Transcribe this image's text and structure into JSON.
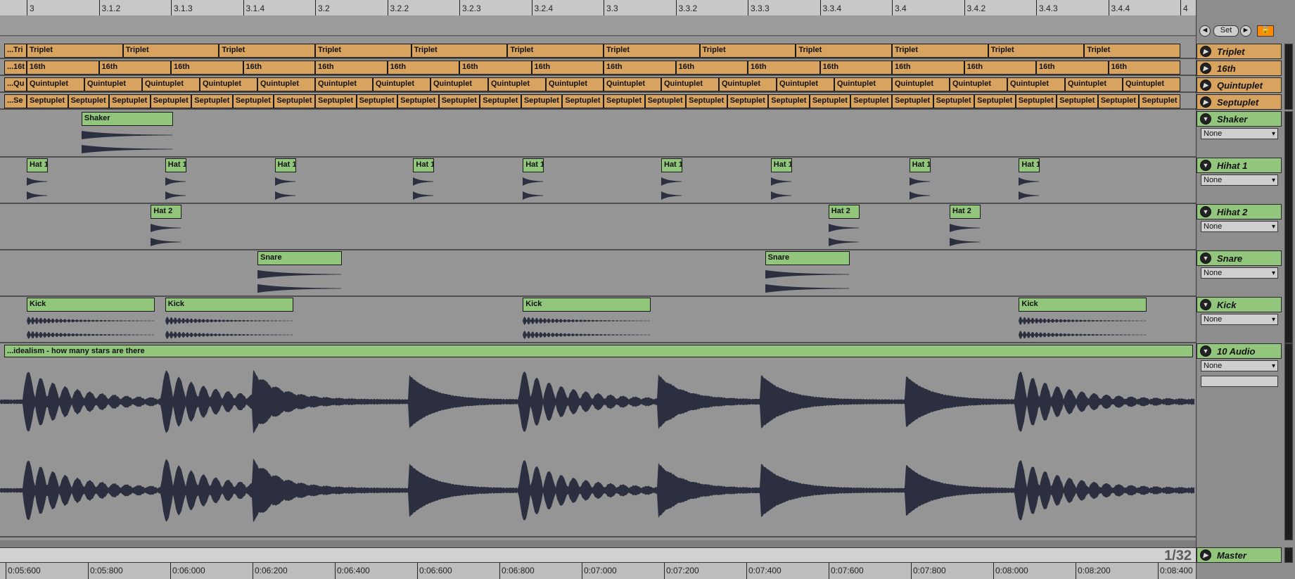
{
  "ruler_top": [
    "3",
    "3.1.2",
    "3.1.3",
    "3.1.4",
    "3.2",
    "3.2.2",
    "3.2.3",
    "3.2.4",
    "3.3",
    "3.3.2",
    "3.3.3",
    "3.3.4",
    "3.4",
    "3.4.2",
    "3.4.3",
    "3.4.4",
    "4"
  ],
  "ruler_bottom": [
    "0:05:600",
    "0:05:800",
    "0:06:000",
    "0:06:200",
    "0:06:400",
    "0:06:600",
    "0:06:800",
    "0:07:000",
    "0:07:200",
    "0:07:400",
    "0:07:600",
    "0:07:800",
    "0:08:000",
    "0:08:200",
    "0:08:400"
  ],
  "controls": {
    "back_label": "◄",
    "set_label": "Set",
    "forward_label": "►",
    "lock_label": "🔒"
  },
  "tracks": {
    "triplet": {
      "name": "Triplet",
      "first_clip": "...Tri",
      "clip": "Triplet",
      "count": 12
    },
    "sixteenth": {
      "name": "16th",
      "first_clip": "...16t",
      "clip": "16th",
      "count": 16
    },
    "quintuplet": {
      "name": "Quintuplet",
      "first_clip": "...Qu",
      "clip": "Quintuplet",
      "count": 20
    },
    "septuplet": {
      "name": "Septuplet",
      "first_clip": "...Se",
      "clip": "Septuplet",
      "count": 28
    },
    "shaker": {
      "name": "Shaker",
      "clip": "Shaker",
      "input": "None"
    },
    "hihat1": {
      "name": "Hihat 1",
      "clip": "Hat 1",
      "input": "None"
    },
    "hihat2": {
      "name": "Hihat 2",
      "clip": "Hat 2",
      "input": "None"
    },
    "snare": {
      "name": "Snare",
      "clip": "Snare",
      "input": "None"
    },
    "kick": {
      "name": "Kick",
      "clip": "Kick",
      "input": "None"
    },
    "audio": {
      "name": "10 Audio",
      "clip": "...idealism - how many stars are there",
      "input": "None"
    },
    "master": {
      "name": "Master"
    }
  },
  "loop_counter": "1/32",
  "colors": {
    "clip_green": "#91c67c",
    "clip_orange": "#d8a35e",
    "waveform": "#2b2f3f"
  }
}
